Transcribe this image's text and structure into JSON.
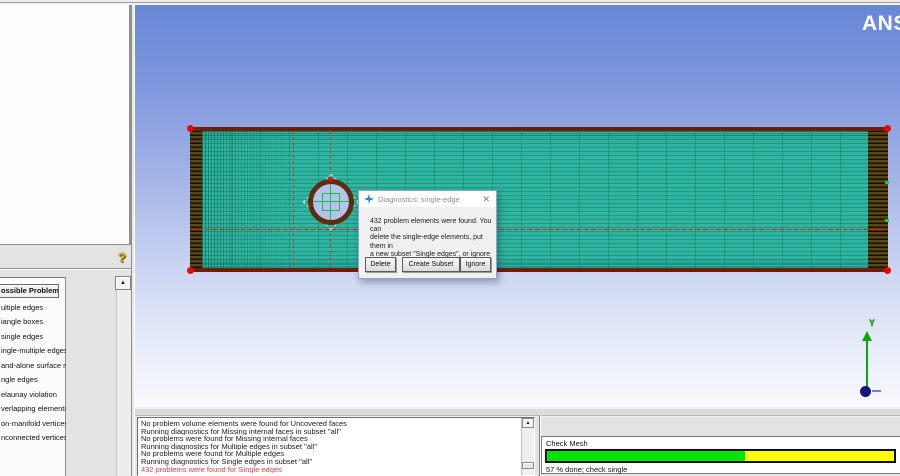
{
  "window": {
    "logo_text": "ANS"
  },
  "left_panel": {
    "help_icon": "?",
    "scroll_up_icon": "▲"
  },
  "problems": {
    "title": "ossible Problems",
    "items": [
      "ultiple edges",
      "iangle boxes",
      "single edges",
      "ingle-multiple edges",
      "and-alone surface mesh",
      "ngle edges",
      "elaunay violation",
      "verlapping elements",
      "on-manifold vertices",
      "nconnected vertices"
    ]
  },
  "dialog": {
    "title": "Diagnostics: single-edge",
    "close_icon": "✕",
    "icon": "icem-star-icon",
    "message_lines": [
      "432 problem elements were found.  You can",
      "delete the single-edge elements, put them in",
      "a new subset \"Single edges\", or ignore"
    ],
    "buttons": [
      "Delete",
      "Create Subset",
      "Ignore"
    ]
  },
  "log": {
    "scroll_up_icon": "▲",
    "lines": [
      {
        "text": "No  problem volume elements  were found for Uncovered faces",
        "error": false
      },
      {
        "text": "Running diagnostics for Missing internal faces in subset ''all''",
        "error": false
      },
      {
        "text": "No  problems  were found for Missing internal faces",
        "error": false
      },
      {
        "text": "Running diagnostics for Multiple edges in subset ''all''",
        "error": false
      },
      {
        "text": "No  problems  were found for Multiple edges",
        "error": false
      },
      {
        "text": "Running diagnostics for Single edges in subset ''all''",
        "error": false
      },
      {
        "text": "432  problems  were found for Single edges",
        "error": true
      }
    ],
    "error_color": "#e04545"
  },
  "progress": {
    "label": "Check Mesh",
    "status": "57 % done; check single",
    "percent": 57,
    "fill_color": "#00e400",
    "remaining_color": "#ffff00"
  },
  "viewport": {
    "triad_y_label": "Y",
    "colors": {
      "background_top": "#6787d6",
      "mesh_teal": "#2db4a0",
      "mesh_border": "#701d06",
      "marker_red": "#e00808",
      "block_green": "#16c24a"
    }
  }
}
